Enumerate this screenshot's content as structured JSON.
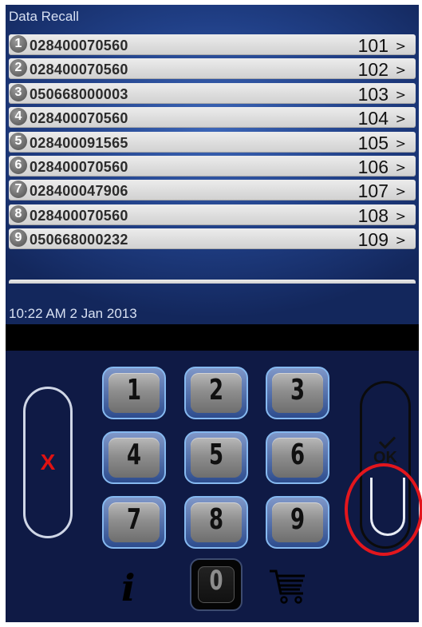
{
  "screen": {
    "title": "Data Recall",
    "timestamp": "10:22 AM 2 Jan 2013",
    "rows": [
      {
        "index": "1",
        "code": "028400070560",
        "number": "101",
        "chevron": ">"
      },
      {
        "index": "2",
        "code": "028400070560",
        "number": "102",
        "chevron": ">"
      },
      {
        "index": "3",
        "code": "050668000003",
        "number": "103",
        "chevron": ">"
      },
      {
        "index": "4",
        "code": "028400070560",
        "number": "104",
        "chevron": ">"
      },
      {
        "index": "5",
        "code": "028400091565",
        "number": "105",
        "chevron": ">"
      },
      {
        "index": "6",
        "code": "028400070560",
        "number": "106",
        "chevron": ">"
      },
      {
        "index": "7",
        "code": "028400047906",
        "number": "107",
        "chevron": ">"
      },
      {
        "index": "8",
        "code": "028400070560",
        "number": "108",
        "chevron": ">"
      },
      {
        "index": "9",
        "code": "050668000232",
        "number": "109",
        "chevron": ">"
      }
    ]
  },
  "keypad": {
    "cancel_label": "X",
    "ok_label": "OK",
    "keys": [
      "1",
      "2",
      "3",
      "4",
      "5",
      "6",
      "7",
      "8",
      "9"
    ],
    "zero": "0",
    "info_label": "i"
  },
  "colors": {
    "screen_blue": "#203f86",
    "panel_navy": "#0f1a45",
    "cancel_red": "#e01212",
    "highlight_red": "#e3161d"
  },
  "icons": [
    "info-icon",
    "cart-icon",
    "checkmark-icon",
    "chevron-right-icon"
  ]
}
